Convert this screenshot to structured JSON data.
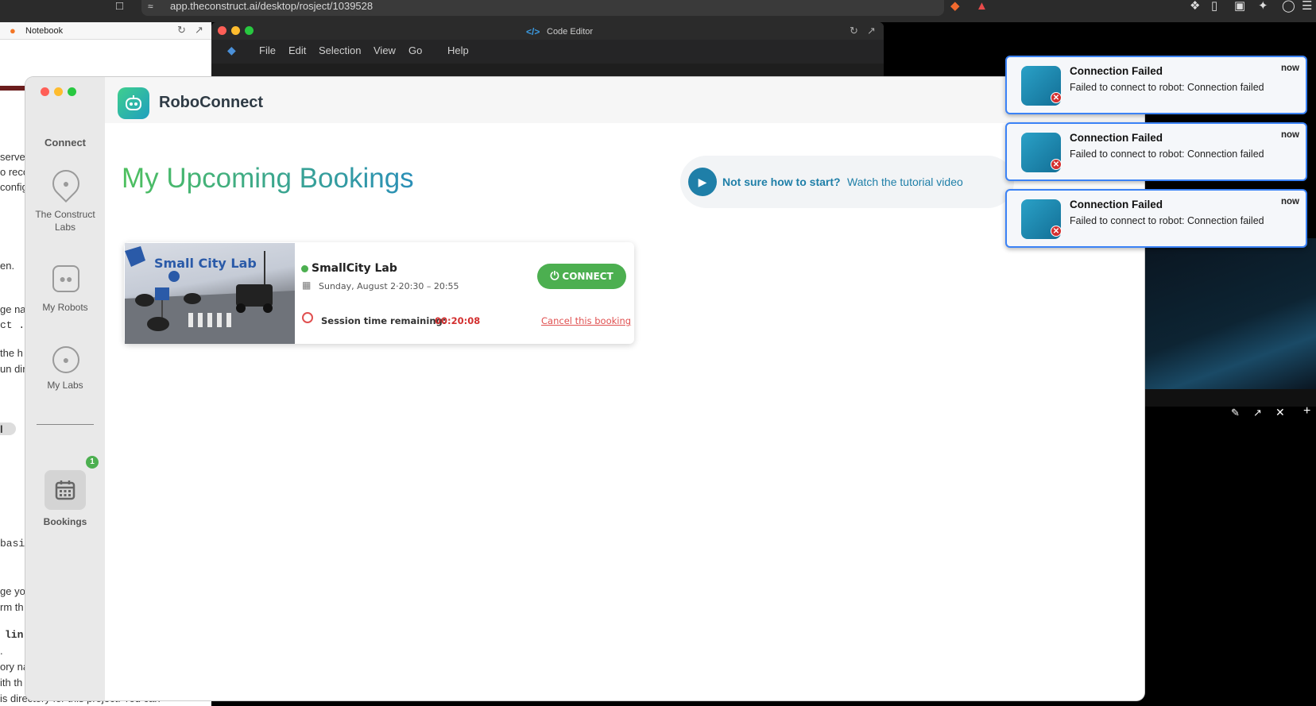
{
  "browser": {
    "url": "app.theconstruct.ai/desktop/rosject/1039528"
  },
  "notebook": {
    "title": "Notebook",
    "fragments": [
      "server",
      "o reco",
      "config",
      "en.",
      "ge na",
      "ct .",
      "the h",
      "un dir",
      "l",
      "basic",
      "ge yo",
      "rm th",
      "lin",
      ".",
      "ory na",
      "ith th",
      "is directory for this project. You can"
    ]
  },
  "code_editor": {
    "title": "Code Editor",
    "menu": [
      "File",
      "Edit",
      "Selection",
      "View",
      "Go",
      "Help"
    ]
  },
  "app": {
    "name": "RoboConnect",
    "sidebar": {
      "header": "Connect",
      "items": [
        {
          "label": "The Construct Labs",
          "icon": "location-pin-icon"
        },
        {
          "label": "My Robots",
          "icon": "robot-icon"
        },
        {
          "label": "My Labs",
          "icon": "lab-icon"
        },
        {
          "label": "Bookings",
          "icon": "calendar-icon",
          "badge": "1"
        }
      ]
    },
    "page_title": "My Upcoming Bookings",
    "tutorial": {
      "question": "Not sure how to start?",
      "link": "Watch the tutorial video"
    },
    "booking": {
      "image_label": "Small City Lab",
      "lab_name": "SmallCity Lab",
      "date": "Sunday, August 2·20:30 – 20:55",
      "session_label": "Session time remaining:",
      "session_time": "00:20:08",
      "connect_label": "CONNECT",
      "cancel_label": "Cancel this booking"
    }
  },
  "toasts": [
    {
      "title": "Connection Failed",
      "body": "Failed to connect to robot: Connection failed",
      "time": "now"
    },
    {
      "title": "Connection Failed",
      "body": "Failed to connect to robot: Connection failed",
      "time": "now"
    },
    {
      "title": "Connection Failed",
      "body": "Failed to connect to robot: Connection failed",
      "time": "now"
    }
  ],
  "colors": {
    "accent_green": "#4caf50",
    "accent_blue": "#1f7fa8",
    "error_red": "#d32f2f",
    "toast_border": "#3b82f6"
  }
}
